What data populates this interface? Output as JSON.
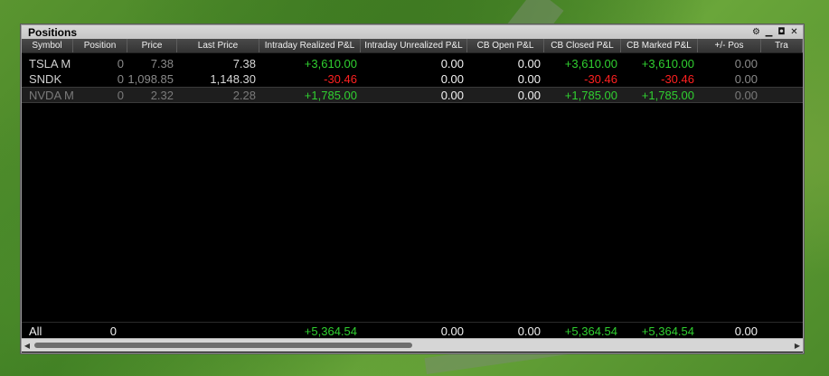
{
  "window": {
    "title": "Positions"
  },
  "controls": {
    "settings": "⚙",
    "minimize": "▁",
    "restore": "◘",
    "close": "✕"
  },
  "columns": [
    "Symbol",
    "Position",
    "Price",
    "Last Price",
    "Intraday Realized P&L",
    "Intraday Unrealized P&L",
    "CB Open P&L",
    "CB Closed P&L",
    "CB Marked P&L",
    "+/- Pos",
    "Tra"
  ],
  "rows": [
    {
      "symbol": "TSLA M",
      "position": "0",
      "price": "7.38",
      "last": "7.38",
      "realized": "+3,610.00",
      "unrealized": "0.00",
      "cb_open": "0.00",
      "cb_closed": "+3,610.00",
      "cb_marked": "+3,610.00",
      "pm_pos": "0.00"
    },
    {
      "symbol": "SNDK",
      "position": "0",
      "price": "1,098.85",
      "last": "1,148.30",
      "realized": "-30.46",
      "unrealized": "0.00",
      "cb_open": "0.00",
      "cb_closed": "-30.46",
      "cb_marked": "-30.46",
      "pm_pos": "0.00"
    },
    {
      "symbol": "NVDA M",
      "position": "0",
      "price": "2.32",
      "last": "2.28",
      "realized": "+1,785.00",
      "unrealized": "0.00",
      "cb_open": "0.00",
      "cb_closed": "+1,785.00",
      "cb_marked": "+1,785.00",
      "pm_pos": "0.00"
    }
  ],
  "totals": {
    "label": "All",
    "position": "0",
    "realized": "+5,364.54",
    "unrealized": "0.00",
    "cb_open": "0.00",
    "cb_closed": "+5,364.54",
    "cb_marked": "+5,364.54",
    "pm_pos": "0.00"
  },
  "scroll": {
    "left": "◀",
    "right": "▶"
  },
  "colors": {
    "positive": "#30d030",
    "negative": "#ff2020",
    "background": "#000000",
    "header": "#3c3c3c"
  }
}
